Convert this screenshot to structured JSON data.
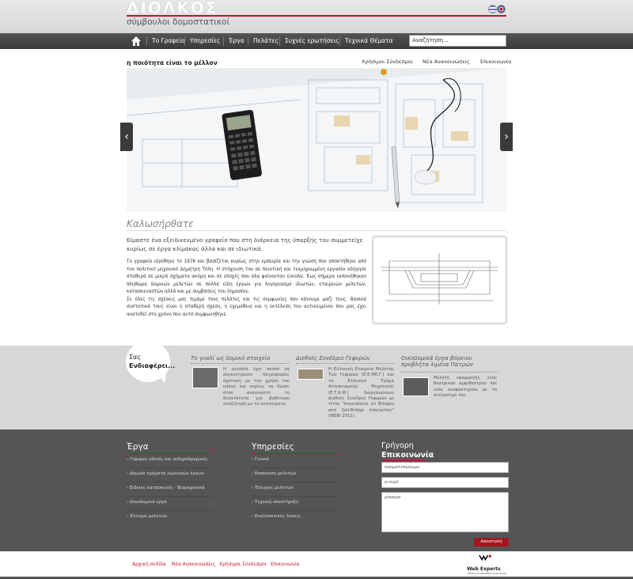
{
  "header": {
    "logo": "ΔΙΟΛΚΟΣ",
    "tagline": "σύμβουλοι δομοστατικοί"
  },
  "nav": {
    "items": [
      "Το Γραφείο",
      "Υπηρεσίες",
      "Έργα",
      "Πελάτες",
      "Συχνές ερωτήσεις",
      "Τεχνικά Θέματα"
    ],
    "search_value": "Αναζήτηση..."
  },
  "top": {
    "slogan": "η ποιότητα είναι το μέλλον",
    "links": [
      "Χρήσιμοι Σύνδεσμοι",
      "Νέα Ανακοινώσεις",
      "Επικοινωνία"
    ]
  },
  "welcome": {
    "title": "Καλωσήρθατε",
    "lead": "Είμαστε ένα εξειδικευμένο γραφείο που στη διάρκεια της ύπαρξής του συμμετείχε κυρίως σε έργα κλίμακας άλλα και σε ιδιωτικά.",
    "p1": "Το γραφείο ιδρύθηκε το 1978 και βασίζεται κυρίως στην εμπειρία και την γνώση που αποκτήθηκε από τον πολιτικό μηχανικό Δημήτρη Τόλη. Η στόχευση του σε ποιοτική και τεκμηριωμένη εργασία οδήγησε σταθερά σε μικρά σχήματα ακόμη και σε εποχές που όλα φαίνονταν εύκολα. Έως σήμερα εκπονήθηκαν πληθώρα δομικών μελετών σε πολλά είδη έργων για λογαριασμό ιδιωτών, εταιρειών μελετών, κατασκευαστών αλλά και με συμβάσεις του δημοσίου.",
    "p2": "Σε όλες τις σχέσεις μας τιμάμε τους πελάτες και τις συμφωνίες που κάνουμε μαζί τους. Βασικά συστατικά τους είναι η σταθερή σχέση, η εχεμύθεια και η εκτέλεση του αντικειμένου που μας έχει ανατεθεί στο χρόνο που αυτό συμφωνήθηκε."
  },
  "interest": {
    "line1": "Σας",
    "line2": "Ενδιαφέρει...",
    "articles": [
      {
        "title": "Το γυαλί ως δομικό στοιχείο",
        "text": "Η εργασία έχει σκοπό να συγκεντρώσει πληροφορίες σχετικές με την χρήση του υαλού και κυρίως να δώσει στον αναγνώστη τη δυνατότητα για βαθύτερη αναζήτηση με το αντικείμενο."
      },
      {
        "title": "Διεθνές Συνέδριο Γεφυρών",
        "text": "Η Ελληνική Εταιρεία Μελέτης Των Γεφυρών (Ε.Ε.ΜΕ.Γ.) και το Ελληνικό Τμήμα Αντισεισμικής Μηχανικής (Ε.Τ.Α.Μ.) διοργανώνουν Διεθνές Συνέδριο Γεφυρών με τίτλο \"Innovations on Bridges and Soil-Bridge Interaction\" (IBSBI 2011)."
      },
      {
        "title": "Οικοδομικά έργα βόρειου προβλήτα λιμένα Πατρών",
        "text": "Μελέτη εφαρμογής ενός θεατρικού αμφιθεάτρου και ενός αναψυκτηρίου με το στέγαστρό του."
      }
    ]
  },
  "footer": {
    "erga_title": "Έργα",
    "erga_items": [
      "Γέφυρες οδικές και σιδηροδρομικές",
      "Δομικά τμήματα λιμενικών έργων",
      "Ειδικές κατασκευές - Βιομηχανικά",
      "Οικοδομικά έργα",
      "Έλεγχοι μελετών"
    ],
    "ypiresies_title": "Υπηρεσίες",
    "ypiresies_items": [
      "Γενικά",
      "Εκπόνηση μελετών",
      "Έλεγχος μελετών",
      "Τεχνική υποστήριξη",
      "Εναλλακτικές λύσεις"
    ],
    "contact_title_1": "Γρήγορη",
    "contact_title_2": "Επικοινωνία",
    "name_placeholder": "ονοματεπώνυμο",
    "email_placeholder": "e-mail",
    "message_placeholder": "μήνυμα",
    "send_label": "Αποστολή"
  },
  "bottom": {
    "links": [
      "Αρχική σελίδα",
      "Νέα Ανακοινώσεις",
      "Χρήσιμοι Σύνδεσμοι",
      "Επικοινωνία"
    ],
    "brand": "Web Experts",
    "brand_sub": "WEB & ECOMMERCE SOLUTIONS"
  },
  "colors": {
    "accent": "#c8102e",
    "nav_bg": "#3b3b3b",
    "footer_bg": "#555555",
    "band_bg": "#d7d7d7"
  }
}
